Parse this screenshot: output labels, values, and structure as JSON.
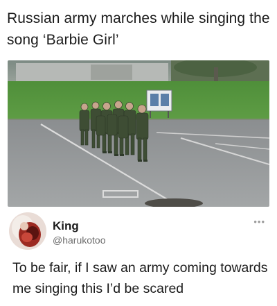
{
  "caption": {
    "text": "Russian army marches while singing the song ‘Barbie Girl’"
  },
  "tweet": {
    "display_name": "King",
    "handle": "@harukotoo",
    "more_icon": "more-options-icon",
    "text": "To be fair, if I saw an army coming towards me singing this I’d be scared"
  },
  "photo": {
    "subject": "soldiers-marching-photo"
  }
}
